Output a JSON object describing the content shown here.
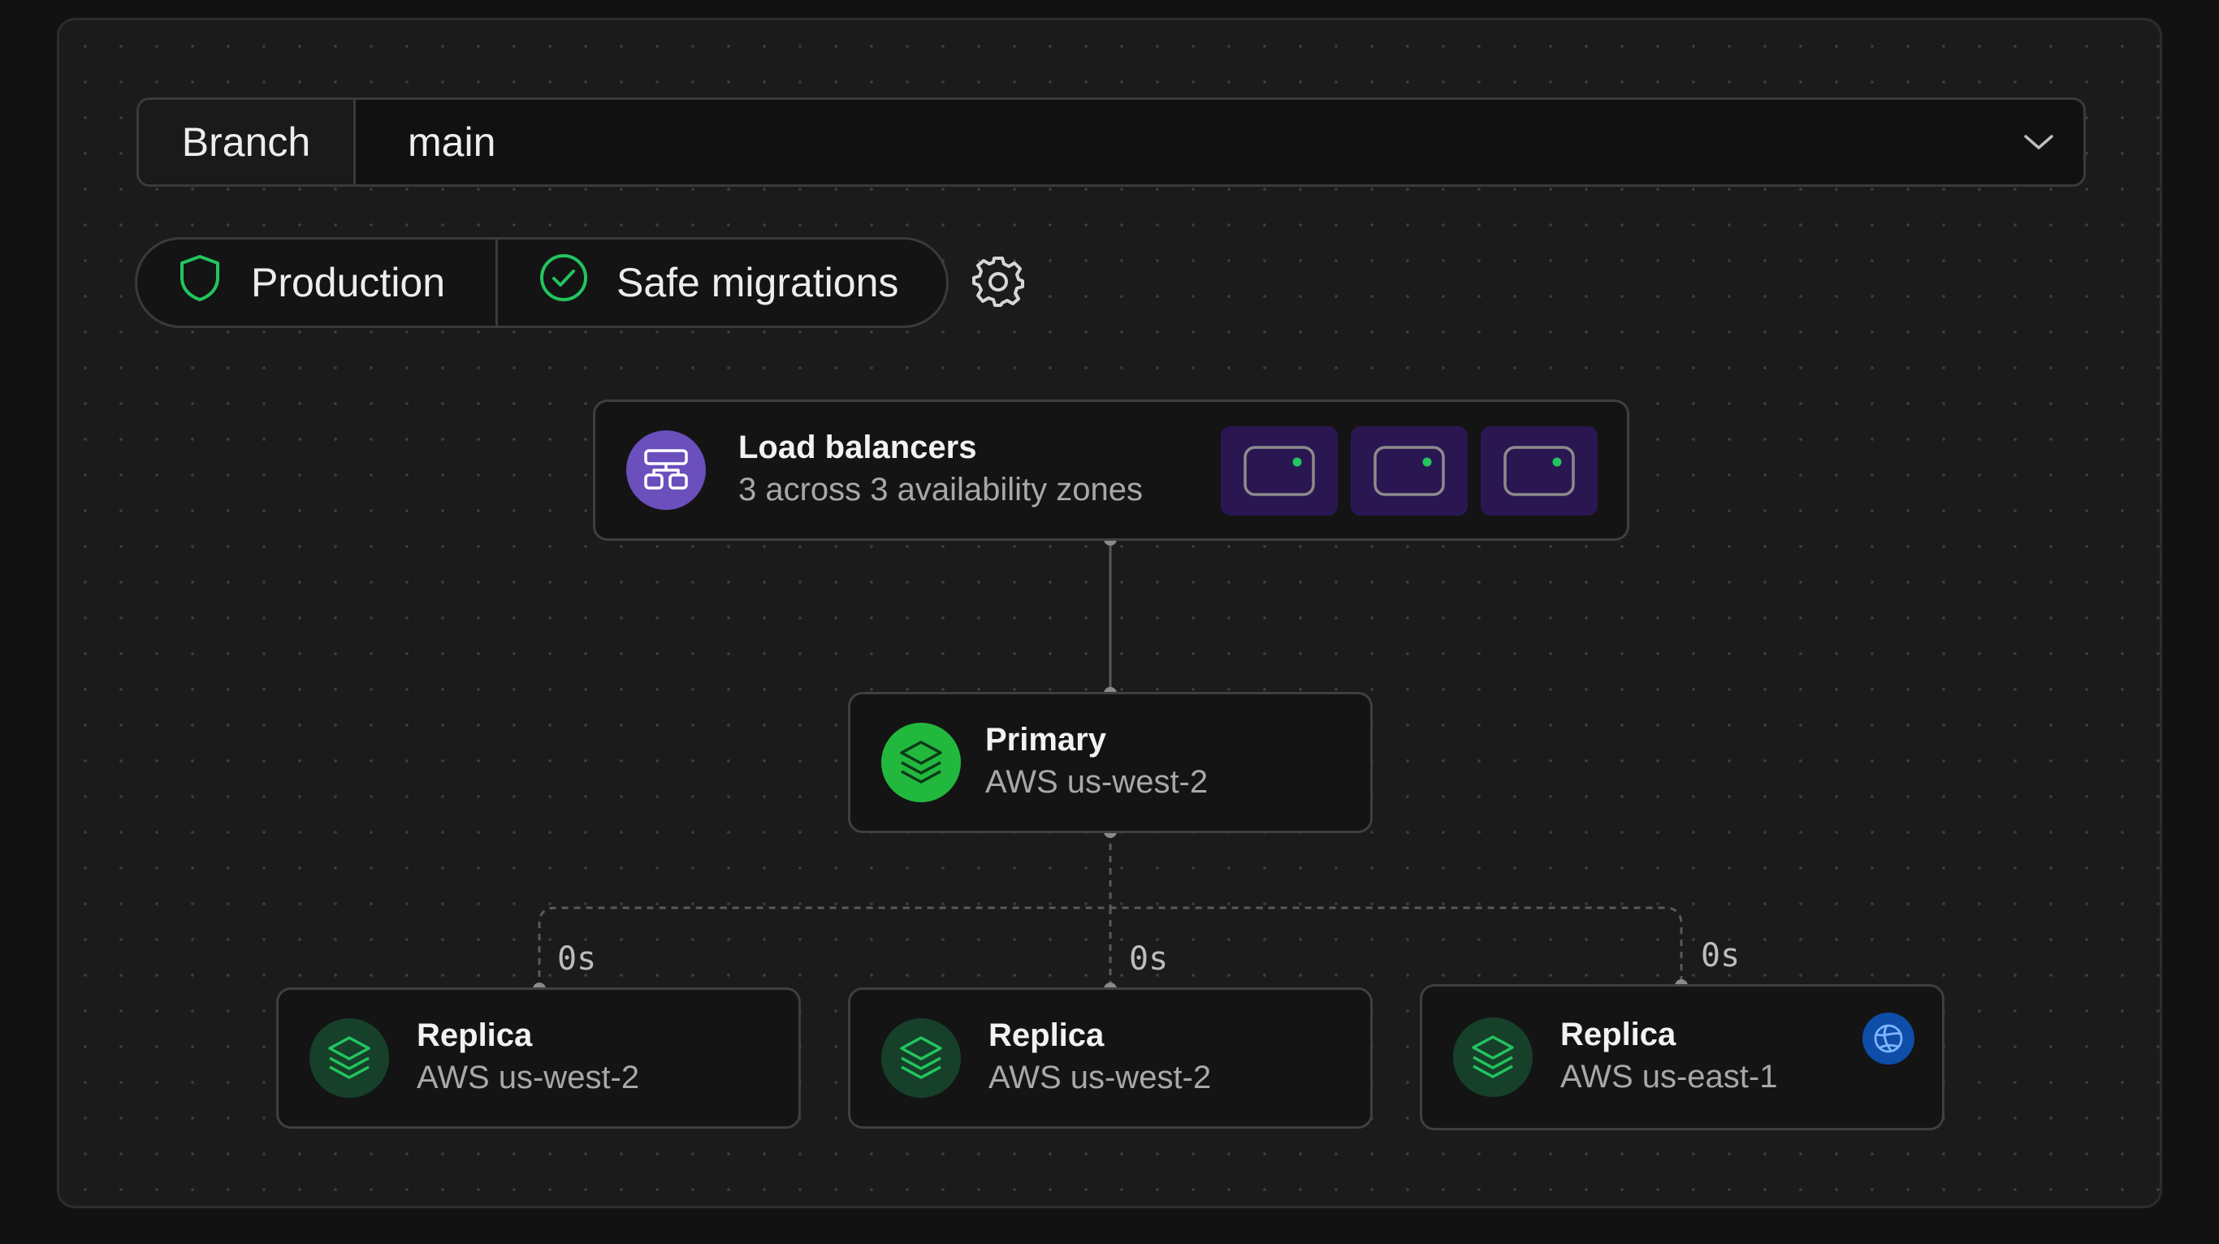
{
  "branch": {
    "label": "Branch",
    "value": "main"
  },
  "status": {
    "environment": "Production",
    "migrations": "Safe migrations"
  },
  "load_balancers": {
    "title": "Load balancers",
    "subtitle": "3 across 3 availability zones",
    "zone_count": 3
  },
  "primary": {
    "title": "Primary",
    "subtitle": "AWS us-west-2"
  },
  "replicas": [
    {
      "title": "Replica",
      "subtitle": "AWS us-west-2",
      "lag": "0s"
    },
    {
      "title": "Replica",
      "subtitle": "AWS us-west-2",
      "lag": "0s"
    },
    {
      "title": "Replica",
      "subtitle": "AWS us-east-1",
      "lag": "0s"
    }
  ],
  "icons": {
    "environment": "shield-icon",
    "migrations": "check-circle-icon",
    "settings": "gear-icon",
    "load_balancer": "network-icon",
    "database": "layers-icon",
    "region": "globe-icon",
    "dropdown": "chevron-down-icon",
    "zone": "server-icon"
  },
  "colors": {
    "accent_green": "#22c55e",
    "lb_purple": "#6a4fbd",
    "zone_bg": "#2a1752",
    "replica_icon_bg": "#16402a",
    "globe_blue": "#0e4da8"
  }
}
